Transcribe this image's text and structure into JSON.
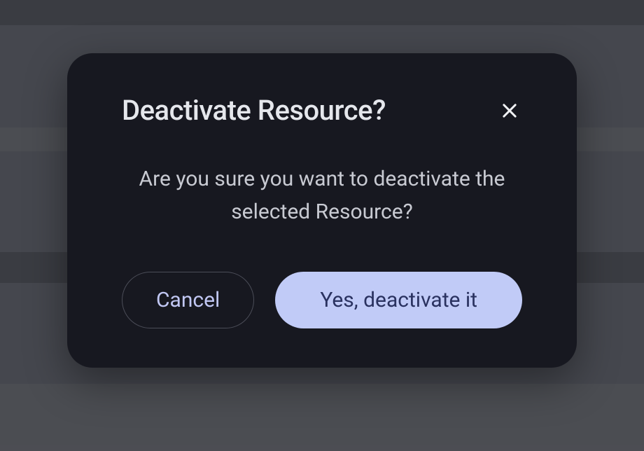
{
  "dialog": {
    "title": "Deactivate Resource?",
    "message": "Are you sure you want to deactivate the selected Resource?",
    "cancel_label": "Cancel",
    "confirm_label": "Yes, deactivate it"
  }
}
